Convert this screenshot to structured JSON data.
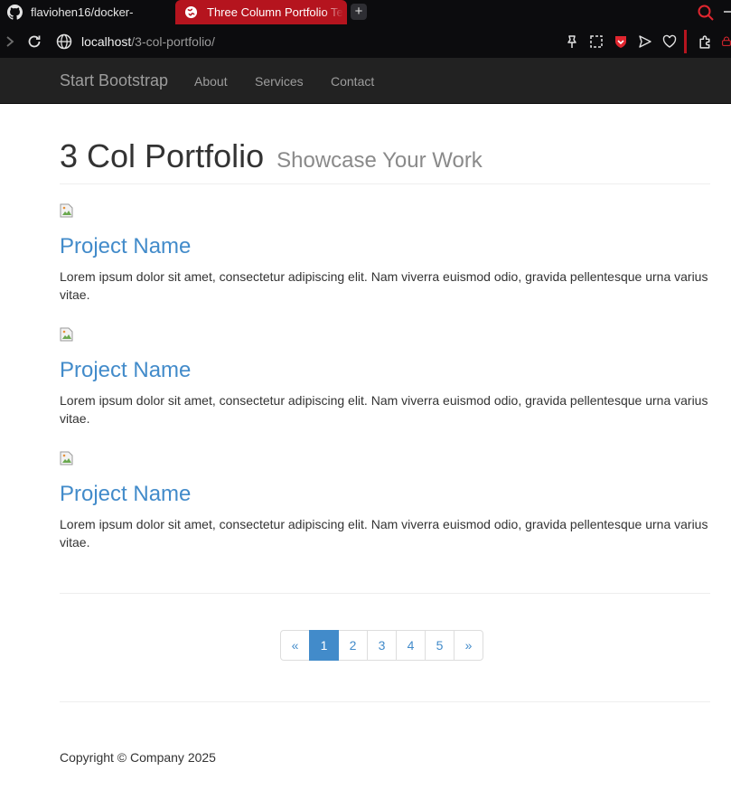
{
  "browser": {
    "tabs": [
      {
        "label": "flaviohen16/docker-",
        "icon": "github-icon",
        "active": false
      },
      {
        "label": "Three Column Portfolio Te",
        "icon": "globe-icon",
        "active": true
      }
    ],
    "new_tab_label": "+",
    "url_host": "localhost",
    "url_path": "/3-col-portfolio/",
    "accent_color": "#b5141e"
  },
  "navbar": {
    "brand": "Start Bootstrap",
    "links": [
      "About",
      "Services",
      "Contact"
    ]
  },
  "header": {
    "title": "3 Col Portfolio",
    "subtitle": "Showcase Your Work"
  },
  "projects": [
    {
      "title": "Project Name",
      "text": "Lorem ipsum dolor sit amet, consectetur adipiscing elit. Nam viverra euismod odio, gravida pellentesque urna varius vitae."
    },
    {
      "title": "Project Name",
      "text": "Lorem ipsum dolor sit amet, consectetur adipiscing elit. Nam viverra euismod odio, gravida pellentesque urna varius vitae."
    },
    {
      "title": "Project Name",
      "text": "Lorem ipsum dolor sit amet, consectetur adipiscing elit. Nam viverra euismod odio, gravida pellentesque urna varius vitae."
    }
  ],
  "pagination": {
    "prev": "«",
    "pages": [
      "1",
      "2",
      "3",
      "4",
      "5"
    ],
    "next": "»",
    "active_page": "1"
  },
  "footer": {
    "copyright": "Copyright © Company 2025"
  }
}
